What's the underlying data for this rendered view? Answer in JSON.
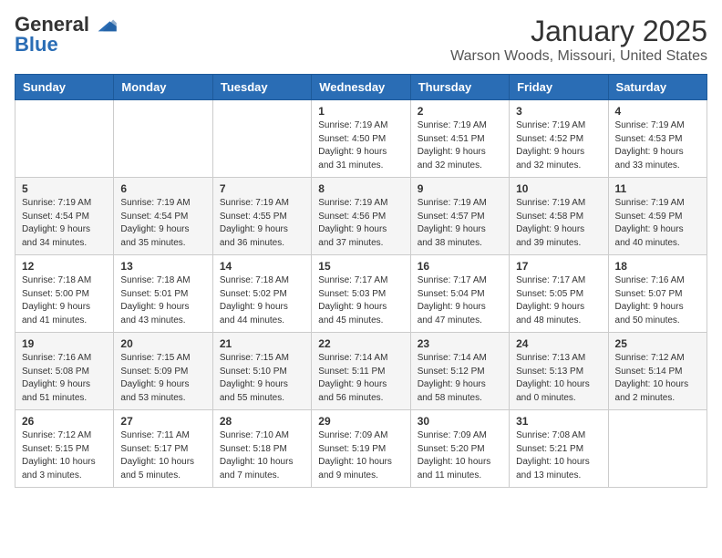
{
  "header": {
    "logo": {
      "general": "General",
      "blue": "Blue"
    },
    "title": "January 2025",
    "subtitle": "Warson Woods, Missouri, United States"
  },
  "weekdays": [
    "Sunday",
    "Monday",
    "Tuesday",
    "Wednesday",
    "Thursday",
    "Friday",
    "Saturday"
  ],
  "weeks": [
    [
      {
        "day": null,
        "info": null
      },
      {
        "day": null,
        "info": null
      },
      {
        "day": null,
        "info": null
      },
      {
        "day": "1",
        "info": "Sunrise: 7:19 AM\nSunset: 4:50 PM\nDaylight: 9 hours and 31 minutes."
      },
      {
        "day": "2",
        "info": "Sunrise: 7:19 AM\nSunset: 4:51 PM\nDaylight: 9 hours and 32 minutes."
      },
      {
        "day": "3",
        "info": "Sunrise: 7:19 AM\nSunset: 4:52 PM\nDaylight: 9 hours and 32 minutes."
      },
      {
        "day": "4",
        "info": "Sunrise: 7:19 AM\nSunset: 4:53 PM\nDaylight: 9 hours and 33 minutes."
      }
    ],
    [
      {
        "day": "5",
        "info": "Sunrise: 7:19 AM\nSunset: 4:54 PM\nDaylight: 9 hours and 34 minutes."
      },
      {
        "day": "6",
        "info": "Sunrise: 7:19 AM\nSunset: 4:54 PM\nDaylight: 9 hours and 35 minutes."
      },
      {
        "day": "7",
        "info": "Sunrise: 7:19 AM\nSunset: 4:55 PM\nDaylight: 9 hours and 36 minutes."
      },
      {
        "day": "8",
        "info": "Sunrise: 7:19 AM\nSunset: 4:56 PM\nDaylight: 9 hours and 37 minutes."
      },
      {
        "day": "9",
        "info": "Sunrise: 7:19 AM\nSunset: 4:57 PM\nDaylight: 9 hours and 38 minutes."
      },
      {
        "day": "10",
        "info": "Sunrise: 7:19 AM\nSunset: 4:58 PM\nDaylight: 9 hours and 39 minutes."
      },
      {
        "day": "11",
        "info": "Sunrise: 7:19 AM\nSunset: 4:59 PM\nDaylight: 9 hours and 40 minutes."
      }
    ],
    [
      {
        "day": "12",
        "info": "Sunrise: 7:18 AM\nSunset: 5:00 PM\nDaylight: 9 hours and 41 minutes."
      },
      {
        "day": "13",
        "info": "Sunrise: 7:18 AM\nSunset: 5:01 PM\nDaylight: 9 hours and 43 minutes."
      },
      {
        "day": "14",
        "info": "Sunrise: 7:18 AM\nSunset: 5:02 PM\nDaylight: 9 hours and 44 minutes."
      },
      {
        "day": "15",
        "info": "Sunrise: 7:17 AM\nSunset: 5:03 PM\nDaylight: 9 hours and 45 minutes."
      },
      {
        "day": "16",
        "info": "Sunrise: 7:17 AM\nSunset: 5:04 PM\nDaylight: 9 hours and 47 minutes."
      },
      {
        "day": "17",
        "info": "Sunrise: 7:17 AM\nSunset: 5:05 PM\nDaylight: 9 hours and 48 minutes."
      },
      {
        "day": "18",
        "info": "Sunrise: 7:16 AM\nSunset: 5:07 PM\nDaylight: 9 hours and 50 minutes."
      }
    ],
    [
      {
        "day": "19",
        "info": "Sunrise: 7:16 AM\nSunset: 5:08 PM\nDaylight: 9 hours and 51 minutes."
      },
      {
        "day": "20",
        "info": "Sunrise: 7:15 AM\nSunset: 5:09 PM\nDaylight: 9 hours and 53 minutes."
      },
      {
        "day": "21",
        "info": "Sunrise: 7:15 AM\nSunset: 5:10 PM\nDaylight: 9 hours and 55 minutes."
      },
      {
        "day": "22",
        "info": "Sunrise: 7:14 AM\nSunset: 5:11 PM\nDaylight: 9 hours and 56 minutes."
      },
      {
        "day": "23",
        "info": "Sunrise: 7:14 AM\nSunset: 5:12 PM\nDaylight: 9 hours and 58 minutes."
      },
      {
        "day": "24",
        "info": "Sunrise: 7:13 AM\nSunset: 5:13 PM\nDaylight: 10 hours and 0 minutes."
      },
      {
        "day": "25",
        "info": "Sunrise: 7:12 AM\nSunset: 5:14 PM\nDaylight: 10 hours and 2 minutes."
      }
    ],
    [
      {
        "day": "26",
        "info": "Sunrise: 7:12 AM\nSunset: 5:15 PM\nDaylight: 10 hours and 3 minutes."
      },
      {
        "day": "27",
        "info": "Sunrise: 7:11 AM\nSunset: 5:17 PM\nDaylight: 10 hours and 5 minutes."
      },
      {
        "day": "28",
        "info": "Sunrise: 7:10 AM\nSunset: 5:18 PM\nDaylight: 10 hours and 7 minutes."
      },
      {
        "day": "29",
        "info": "Sunrise: 7:09 AM\nSunset: 5:19 PM\nDaylight: 10 hours and 9 minutes."
      },
      {
        "day": "30",
        "info": "Sunrise: 7:09 AM\nSunset: 5:20 PM\nDaylight: 10 hours and 11 minutes."
      },
      {
        "day": "31",
        "info": "Sunrise: 7:08 AM\nSunset: 5:21 PM\nDaylight: 10 hours and 13 minutes."
      },
      {
        "day": null,
        "info": null
      }
    ]
  ]
}
